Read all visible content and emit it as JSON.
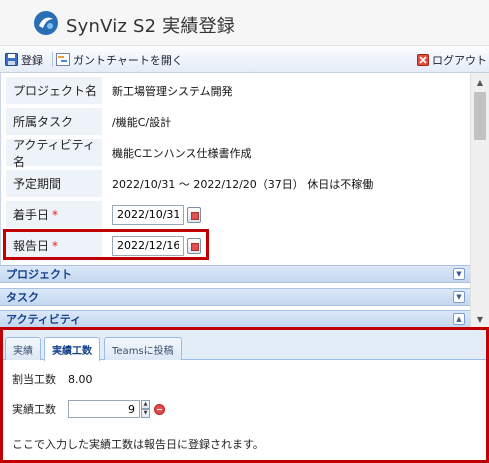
{
  "header": {
    "title": "SynViz S2 実績登録"
  },
  "toolbar": {
    "register_label": "登録",
    "gantt_label": "ガントチャートを開く",
    "logout_label": "ログアウト"
  },
  "form": {
    "project": {
      "label": "プロジェクト名",
      "value": "新工場管理システム開発"
    },
    "task": {
      "label": "所属タスク",
      "value": "/機能C/設計"
    },
    "activity": {
      "label": "アクティビティ名",
      "value": "機能Cエンハンス仕様書作成"
    },
    "period": {
      "label": "予定期間",
      "value": "2022/10/31 ～ 2022/12/20（37日） 休日は不稼働"
    },
    "start_date": {
      "label": "着手日",
      "required_mark": "*",
      "value": "2022/10/31"
    },
    "report_date": {
      "label": "報告日",
      "required_mark": "*",
      "value": "2022/12/16"
    }
  },
  "panels": [
    {
      "label": "プロジェクト",
      "state": "collapsed"
    },
    {
      "label": "タスク",
      "state": "collapsed"
    },
    {
      "label": "アクティビティ",
      "state": "expanded"
    }
  ],
  "tabs": [
    {
      "label": "実績",
      "active": false
    },
    {
      "label": "実績工数",
      "active": true
    },
    {
      "label": "Teamsに投稿",
      "active": false
    }
  ],
  "effort": {
    "allocated_label": "割当工数",
    "allocated_value": "8.00",
    "actual_label": "実績工数",
    "actual_value": "9",
    "note": "ここで入力した実績工数は報告日に登録されます。"
  },
  "colors": {
    "highlight": "#c00000",
    "panel_header_text": "#15428b",
    "label_bg": "#eef3fa"
  },
  "icons": {
    "logo": "synviz-logo-icon",
    "save": "save-icon",
    "gantt": "gantt-chart-icon",
    "logout": "logout-icon",
    "calendar": "calendar-icon",
    "remove": "remove-icon"
  }
}
